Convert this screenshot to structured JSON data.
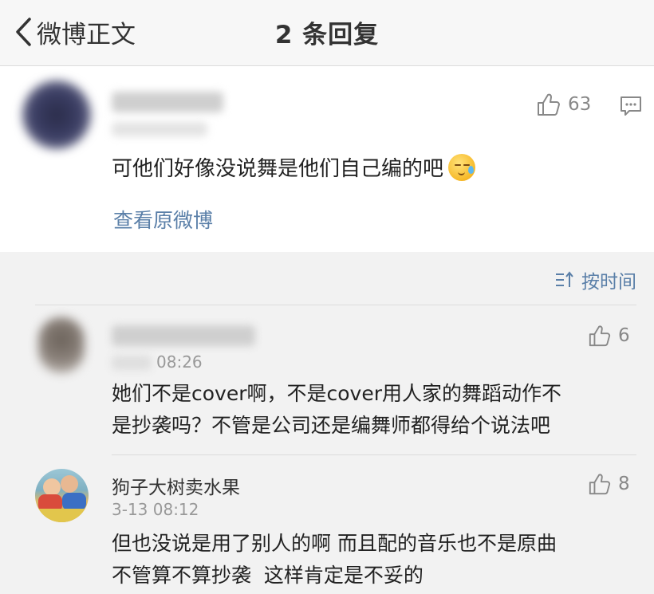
{
  "nav": {
    "back_label": "微博正文",
    "title": "2 条回复"
  },
  "main_comment": {
    "text": "可他们好像没说舞是他们自己编的吧",
    "likes": "63",
    "view_original": "查看原微博"
  },
  "sort": {
    "label": "按时间"
  },
  "replies": [
    {
      "time_partial": "08:26",
      "likes": "6",
      "text_line1": "她们不是cover啊，不是cover用人家的舞蹈动作不",
      "text_line2": "是抄袭吗？不管是公司还是编舞师都得给个说法吧"
    },
    {
      "name": "狗子大树卖水果",
      "time": "3-13 08:12",
      "likes": "8",
      "text_line1": "但也没说是用了别人的啊 而且配的音乐也不是原曲",
      "text_line2": "不管算不算抄袭  这样肯定是不妥的"
    }
  ],
  "icons": {
    "back": "chevron-left-icon",
    "like": "thumbs-up-icon",
    "reply": "comment-icon",
    "sort": "sort-icon",
    "emoji": "sweat-emoji-icon"
  },
  "colors": {
    "link": "#5a7fa8",
    "meta": "#999999",
    "background": "#f2f2f2"
  }
}
